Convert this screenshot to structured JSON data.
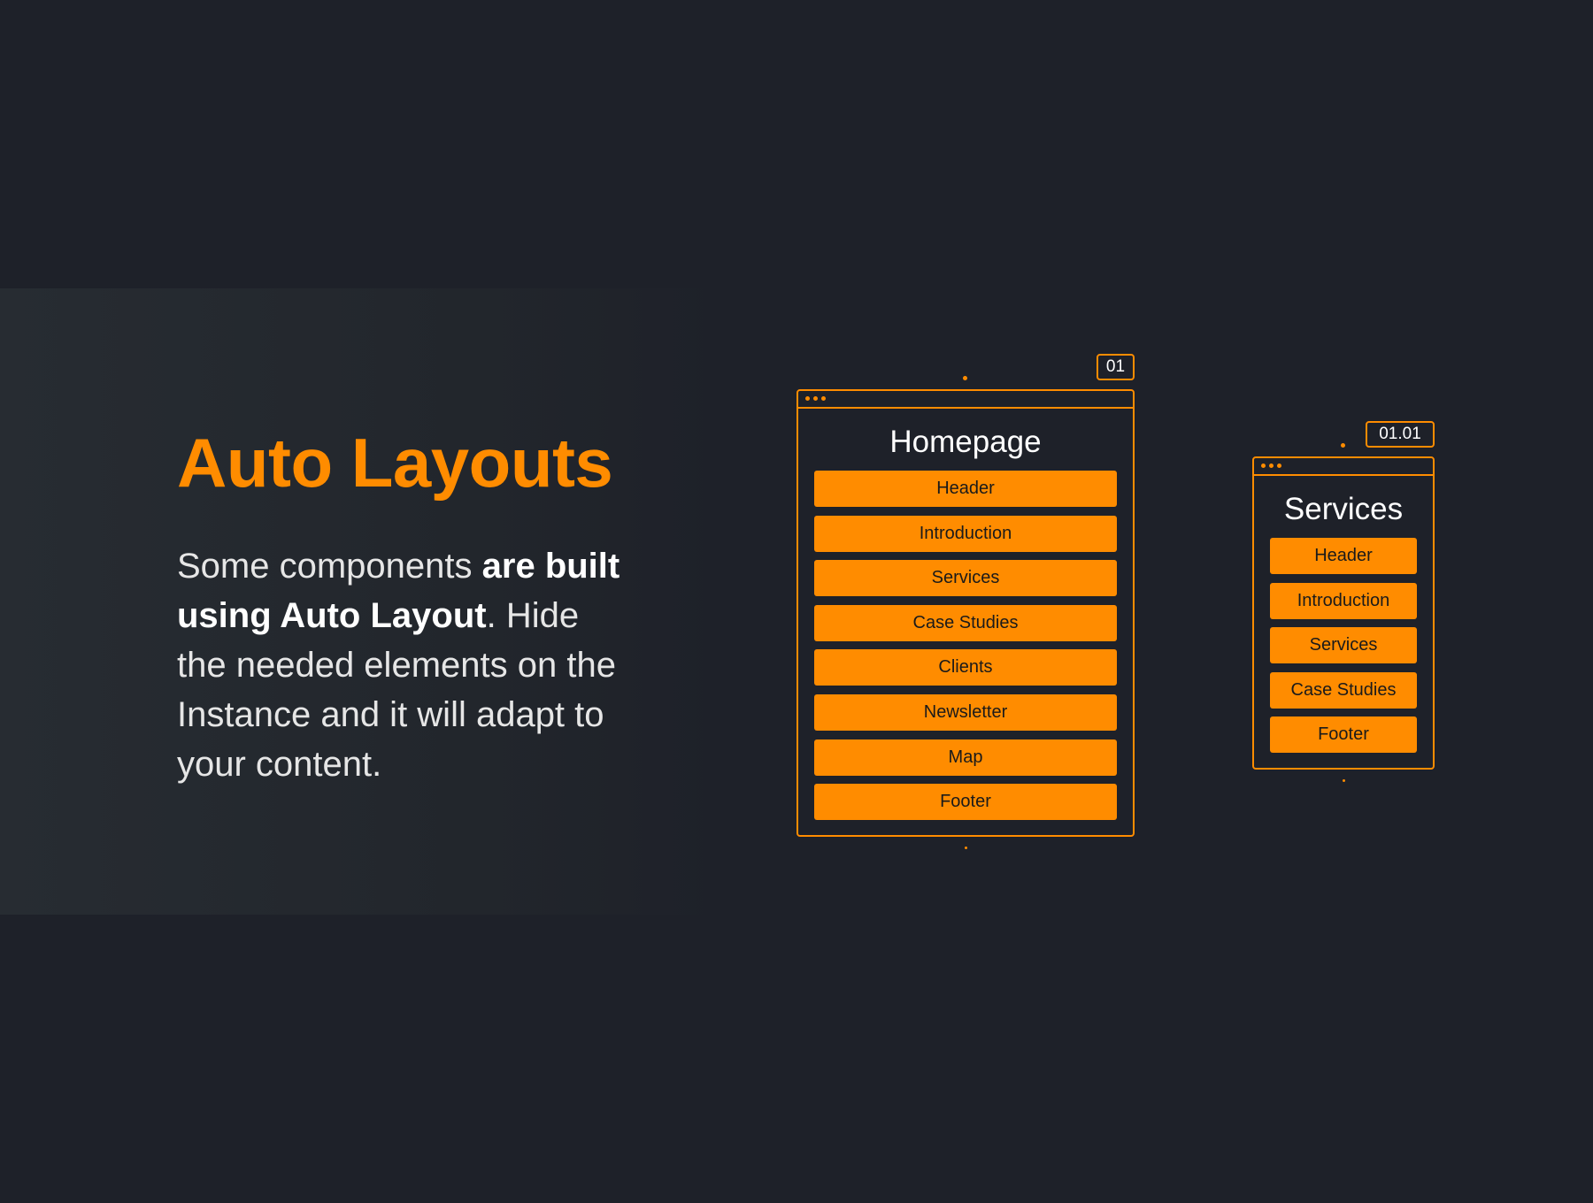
{
  "hero": {
    "title": "Auto Layouts",
    "desc_part1": "Some components ",
    "desc_bold1": "are built using Auto Layout",
    "desc_part2": ". Hide the needed elements on the Instance and it will adapt to your content."
  },
  "frames": [
    {
      "badge": "01",
      "title": "Homepage",
      "items": [
        "Header",
        "Introduction",
        "Services",
        "Case Studies",
        "Clients",
        "Newsletter",
        "Map",
        "Footer"
      ]
    },
    {
      "badge": "01.01",
      "title": "Services",
      "items": [
        "Header",
        "Introduction",
        "Services",
        "Case Studies",
        "Footer"
      ]
    }
  ],
  "colors": {
    "background": "#1e2129",
    "accent": "#ff8c00",
    "text": "#ffffff"
  }
}
